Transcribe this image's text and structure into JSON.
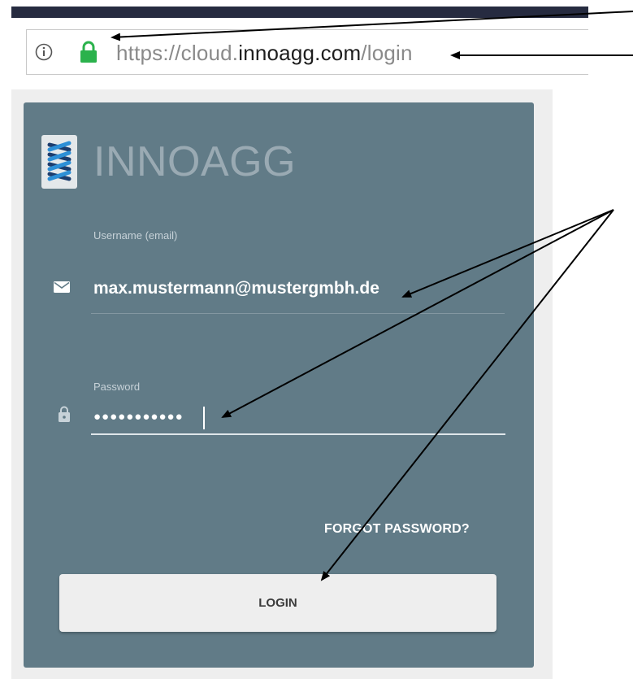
{
  "browser": {
    "url_scheme_prefix": "https://cloud.",
    "url_host": "innoagg.com",
    "url_path": "/login",
    "info_icon": "info-circle-icon",
    "lock_icon": "padlock-icon",
    "lock_color": "#2bb24c"
  },
  "app": {
    "brand": "INNOAGG",
    "card_color": "#617b87"
  },
  "form": {
    "username": {
      "label": "Username (email)",
      "value": "max.mustermann@mustergmbh.de",
      "icon": "envelope-icon"
    },
    "password": {
      "label": "Password",
      "masked_value": "●●●●●●●●●●●",
      "icon": "lock-icon"
    },
    "forgot_label": "FORGOT PASSWORD?",
    "login_label": "LOGIN"
  },
  "annotations": {
    "arrow_count": 5
  }
}
